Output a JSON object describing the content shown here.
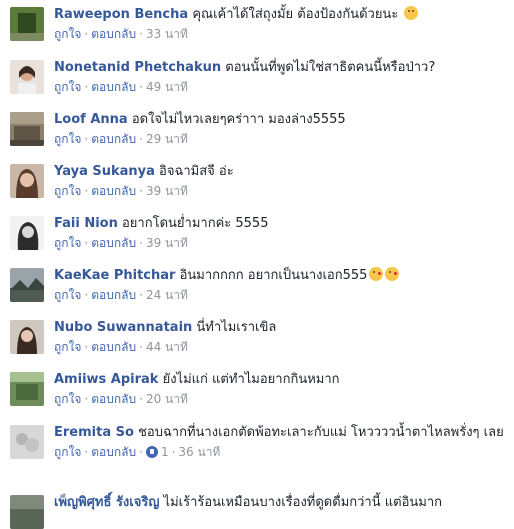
{
  "actions": {
    "like": "ถูกใจ",
    "reply": "ตอบกลับ"
  },
  "comments": [
    {
      "author": "Raweepon Bencha",
      "text": "คุณเค้าได้ใส่ถุงมั้ย ต้องป้องกันด้วยนะ",
      "time": "33 นาที",
      "emoji": "tongue-face"
    },
    {
      "author": "Nonetanid Phetchakun",
      "text": "ตอนนั้นที่พูดไม่ใช่สาธิตคนนี้หรือป่าว?",
      "time": "49 นาที"
    },
    {
      "author": "Loof Anna",
      "text": "อดใจไม่ไหวเลยๆคร่าาา มองล่าง5555",
      "time": "29 นาที"
    },
    {
      "author": "Yaya Sukanya",
      "text": "อิจฉามิสจี อ่ะ",
      "time": "39 นาที"
    },
    {
      "author": "Faii Nion",
      "text": "อยากโดนย่ำมากค่ะ 5555",
      "time": "39 นาที"
    },
    {
      "author": "KaeKae Phitchar",
      "text": "อินมากกกก อยากเป็นนางเอก555",
      "time": "24 นาที",
      "emoji": "kiss-face"
    },
    {
      "author": "Nubo Suwannatain",
      "text": "นี่ทำไมเราเขิล",
      "time": "44 นาที"
    },
    {
      "author": "Amiiws Apirak",
      "text": "ยังไม่แก่ แต่ทำไมอยากกินหมาก",
      "time": "20 นาที"
    },
    {
      "author": "Eremita So",
      "text": "ชอบฉากที่นางเอกตัดพ้อทะเลาะกับแม่ โหววววน้ำตาไหลพรั่งๆ เลย",
      "time": "36 นาที",
      "likes": "1"
    },
    {
      "author": "เพ็ญพิศุทธิ์ รังเจริญ",
      "text": "ไม่เร้าร้อนเหมือนบางเรื่องที่ดูดดื่มกว่านี้ แต่อินมาก",
      "time": ""
    }
  ],
  "colors": {
    "name": "#365899",
    "link": "#4267b2",
    "meta": "#90949c",
    "text": "#1d2129"
  }
}
